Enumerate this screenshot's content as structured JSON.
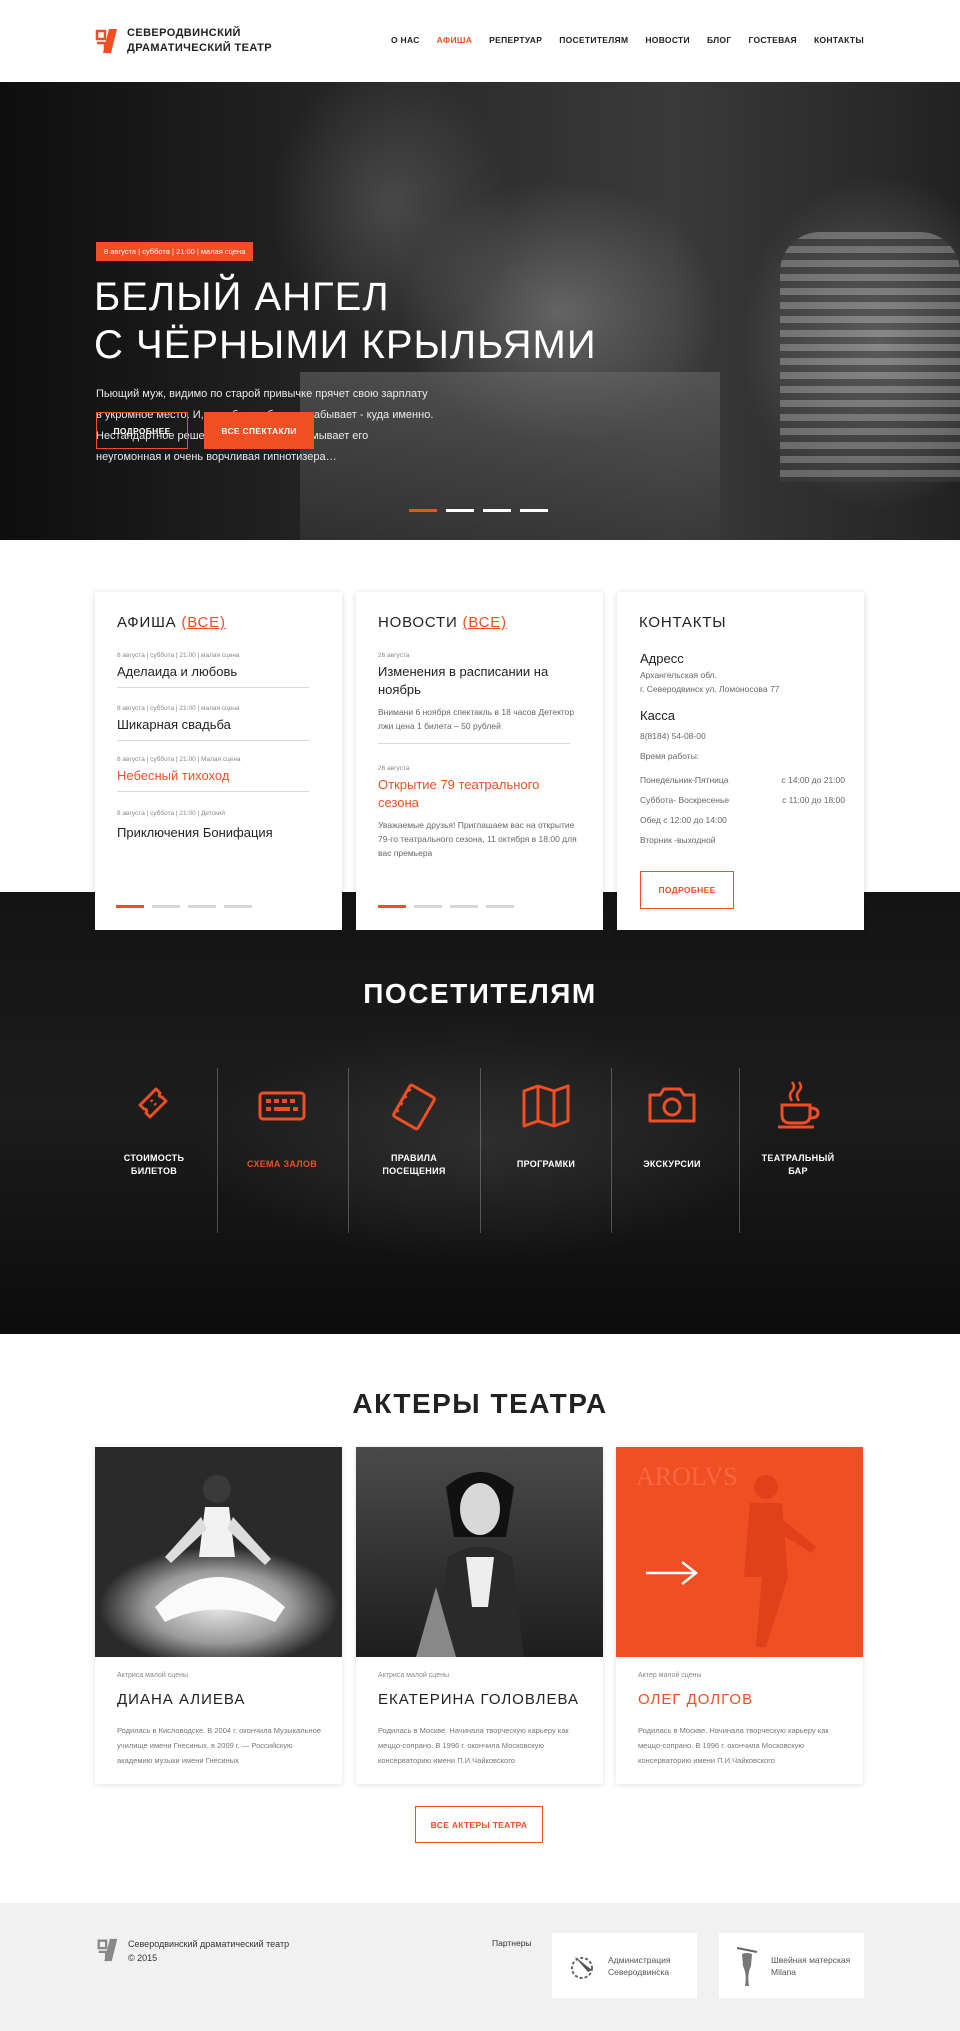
{
  "header": {
    "logo_line1": "Северодвинский",
    "logo_line2": "драматический театр",
    "nav": [
      "О НАС",
      "АФИША",
      "РЕПЕРТУАР",
      "ПОСЕТИТЕЛЯМ",
      "НОВОСТИ",
      "БЛОГ",
      "ГОСТЕВАЯ",
      "КОНТАКТЫ"
    ],
    "active_nav": "АФИША"
  },
  "hero": {
    "tag": "8 августа | суббота | 21:00 | малая сцена",
    "title_line1": "БЕЛЫЙ АНГЕЛ",
    "title_line2": "С ЧЁРНЫМИ КРЫЛЬЯМИ",
    "desc_lines": [
      "Пьющий муж, видимо по старой привычке прячет свою зарплату",
      "в укромное место. И, как обычно бывает, забывает - куда именно.",
      "Нестандартное решение проблемы придумывает его",
      "неугомонная и очень ворчливая гипнотизера…"
    ],
    "btn_more": "ПОДРОБНЕЕ",
    "btn_all": "ВСЕ СПЕКТАКЛИ",
    "slides": 4,
    "active_slide": 1
  },
  "afisha": {
    "title": "АФИША",
    "all_link": "(ВСЕ)",
    "events": [
      {
        "meta": "8 августа | суббота | 21:00 | малая сцена",
        "name": "Аделаида и любовь"
      },
      {
        "meta": "8 августа | суббота | 21:00 | малая сцена",
        "name": "Шикарная свадьба"
      },
      {
        "meta": "8 августа | суббота | 21:00 | Малая сцена",
        "name": "Небесный тихоход"
      },
      {
        "meta": "8 августа | суббота | 21:00 | Детский",
        "name": "Приключения Бонифация"
      }
    ]
  },
  "news": {
    "title": "НОВОСТИ",
    "all_link": "(ВСЕ)",
    "items": [
      {
        "date": "26 августа",
        "title": "Изменения в расписании на ноябрь",
        "text": "Внимани 6 ноября спектакль в 18 часов Детектор лжи цена 1 билета – 50 рублей"
      },
      {
        "date": "26 августа",
        "title": "Открытие 79 театрального сезона",
        "text": "Уважаемые друзья! Приглашаем вас на открытие 79-го театрального сезона, 11 октября в 18:00 для вас премьера"
      }
    ]
  },
  "contacts": {
    "title": "КОНТАКТЫ",
    "address_label": "Адресс",
    "address_1": "Архангельская обл.",
    "address_2": "г. Северодвинск ул. Ломоносова 77",
    "kassa_label": "Касса",
    "phone": "8(8184) 54-08-00",
    "hours_label": "Время работы:",
    "hours": [
      {
        "day": "Понедельник-Пятница",
        "time": "с 14:00 до 21:00"
      },
      {
        "day": "Суббота- Воскресенье",
        "time": "с 11:00 до 18:00"
      }
    ],
    "lunch": "Обед с 12:00 до 14:00",
    "dayoff": "Вторник -выходной",
    "btn": "ПОДРОБНЕЕ"
  },
  "visitors": {
    "title": "ПОСЕТИТЕЛЯМ",
    "items": [
      {
        "label1": "СТОИМОСТЬ",
        "label2": "БИЛЕТОВ",
        "icon": "ticket-icon"
      },
      {
        "label1": "СХЕМА ЗАЛОВ",
        "label2": "",
        "icon": "keyboard-icon"
      },
      {
        "label1": "ПРАВИЛА",
        "label2": "ПОСЕЩЕНИЯ",
        "icon": "notebook-icon"
      },
      {
        "label1": "ПРОГРАМКИ",
        "label2": "",
        "icon": "map-icon"
      },
      {
        "label1": "ЭКСКУРСИИ",
        "label2": "",
        "icon": "camera-icon"
      },
      {
        "label1": "ТЕАТРАЛЬНЫЙ",
        "label2": "БАР",
        "icon": "coffee-icon"
      }
    ]
  },
  "actors": {
    "title": "АКТЕРЫ ТЕАТРА",
    "list": [
      {
        "role": "Актриса малой сцены",
        "name": "ДИАНА АЛИЕВА",
        "bio": "Родилась в Кисловодске. В 2004 г. окончила Музыкальное училище имени Гнесиных, в 2009 г. — Российскую академию музыки имени Гнесиных"
      },
      {
        "role": "Актриса малой сцены",
        "name": "ЕКАТЕРИНА ГОЛОВЛЕВА",
        "bio": "Родилась в Москве. Начинала творческую карьеру как меццо-сопрано. В 1996 г. окончила Московскую консерваторию имени П.И.Чайковского"
      },
      {
        "role": "Актер малой сцены",
        "name": "ОЛЕГ ДОЛГОВ",
        "bio": "Родилась в Москве. Начинала творческую карьеру как меццо-сопрано. В 1996 г. окончила Московскую консерваторию имени П.И.Чайковского"
      }
    ],
    "all_btn": "ВСЕ АКТЕРЫ ТЕАТРА"
  },
  "footer": {
    "name": "Северодвинский драматический театр",
    "year": "© 2015",
    "partners_label": "Партнеры",
    "partners": [
      {
        "line1": "Администрация",
        "line2": "Северодвинска"
      },
      {
        "line1": "Швейная матерская",
        "line2": "Milana"
      }
    ]
  },
  "colors": {
    "accent": "#f04e23"
  }
}
